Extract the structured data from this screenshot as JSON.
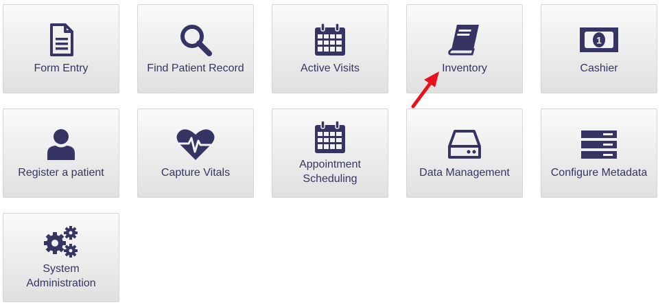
{
  "apps": [
    {
      "label": "Form Entry",
      "icon": "document-icon"
    },
    {
      "label": "Find Patient Record",
      "icon": "search-icon"
    },
    {
      "label": "Active Visits",
      "icon": "calendar-icon"
    },
    {
      "label": "Inventory",
      "icon": "book-icon"
    },
    {
      "label": "Cashier",
      "icon": "money-icon"
    },
    {
      "label": "Register a patient",
      "icon": "user-icon"
    },
    {
      "label": "Capture Vitals",
      "icon": "heartbeat-icon"
    },
    {
      "label": "Appointment Scheduling",
      "icon": "calendar-icon"
    },
    {
      "label": "Data Management",
      "icon": "hard-drive-icon"
    },
    {
      "label": "Configure Metadata",
      "icon": "server-icon"
    },
    {
      "label": "System Administration",
      "icon": "gears-icon"
    }
  ],
  "colors": {
    "icon": "#363463",
    "label": "#363463",
    "arrow": "#e8121b"
  }
}
